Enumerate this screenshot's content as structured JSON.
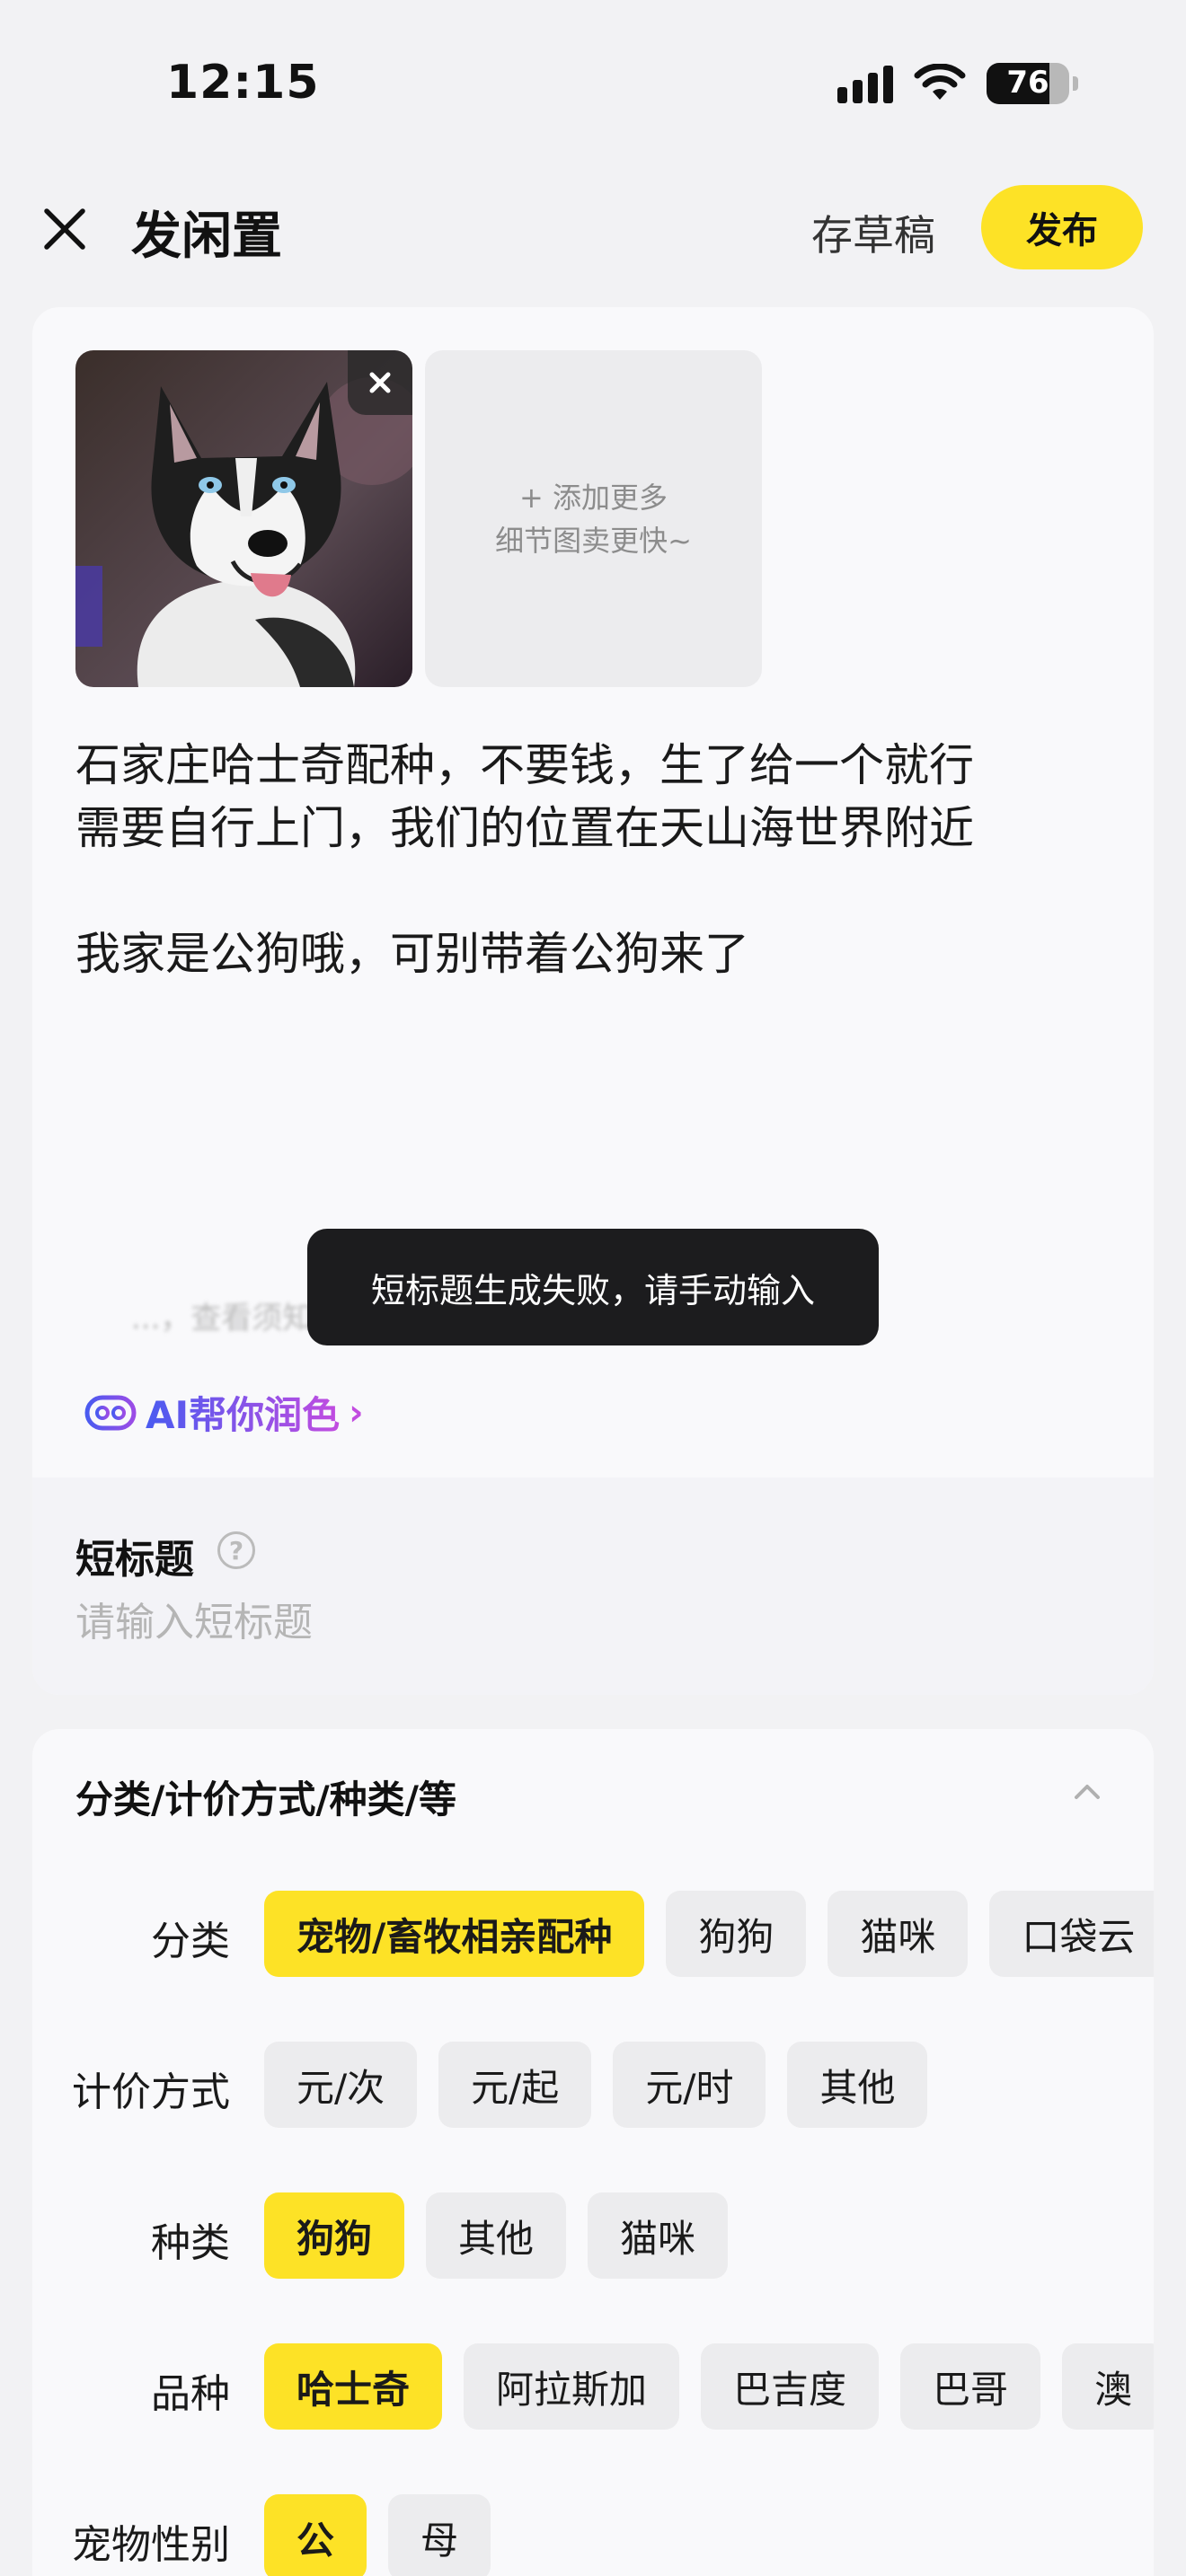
{
  "status_bar": {
    "time": "12:15",
    "battery": "76",
    "battery_level": 0.76
  },
  "header": {
    "title": "发闲置",
    "draft_label": "存草稿",
    "publish_label": "发布"
  },
  "photos": {
    "add_more_line1": "+ 添加更多",
    "add_more_line2": "细节图卖更快~"
  },
  "description": {
    "lines": [
      "石家庄哈士奇配种，不要钱，生了给一个就行",
      "需要自行上门，我们的位置在天山海世界附近",
      "",
      "我家是公狗哦，可别带着公狗来了"
    ],
    "ghost_hint": "...，查看须知"
  },
  "toast": "短标题生成失败，请手动输入",
  "ai_assist": {
    "label": "AI帮你润色",
    "chevron": "›"
  },
  "short_title": {
    "label": "短标题",
    "help": "?",
    "placeholder": "请输入短标题",
    "value": ""
  },
  "attributes": {
    "header": "分类/计价方式/种类/等",
    "rows": [
      {
        "label": "分类",
        "options": [
          "宠物/畜牧相亲配种",
          "狗狗",
          "猫咪",
          "口袋云"
        ],
        "selected": 0
      },
      {
        "label": "计价方式",
        "options": [
          "元/次",
          "元/起",
          "元/时",
          "其他"
        ],
        "selected": -1
      },
      {
        "label": "种类",
        "options": [
          "狗狗",
          "其他",
          "猫咪"
        ],
        "selected": 0
      },
      {
        "label": "品种",
        "options": [
          "哈士奇",
          "阿拉斯加",
          "巴吉度",
          "巴哥",
          "澳"
        ],
        "selected": 0
      },
      {
        "label": "宠物性别",
        "options": [
          "公",
          "母"
        ],
        "selected": 0
      }
    ]
  },
  "colors": {
    "accent": "#fde226",
    "background": "#f2f2f4",
    "card": "#f9f9fb"
  }
}
